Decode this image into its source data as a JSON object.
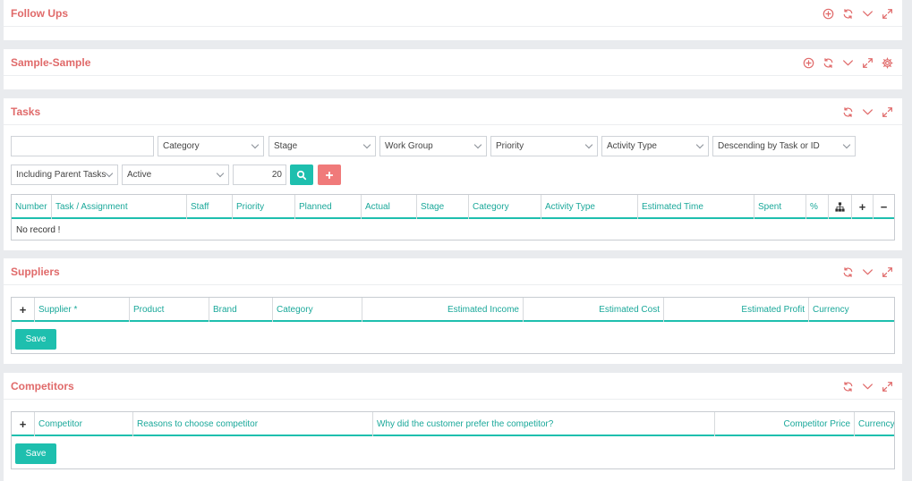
{
  "follow_ups": {
    "title": "Follow Ups"
  },
  "sample": {
    "title": "Sample-Sample"
  },
  "tasks": {
    "title": "Tasks",
    "search": {
      "value": "",
      "placeholder": ""
    },
    "filters": {
      "category": "Category",
      "stage": "Stage",
      "work_group": "Work Group",
      "priority": "Priority",
      "activity_type": "Activity Type",
      "sort": "Descending by Task or ID",
      "parent_tasks": "Including Parent Tasks",
      "status": "Active",
      "page_size": "20"
    },
    "columns": [
      "Number",
      "Task / Assignment",
      "Staff",
      "Priority",
      "Planned",
      "Actual",
      "Stage",
      "Category",
      "Activity Type",
      "Estimated Time",
      "Spent",
      "%"
    ],
    "empty_text": "No record !"
  },
  "suppliers": {
    "title": "Suppliers",
    "columns": [
      "Supplier *",
      "Product",
      "Brand",
      "Category",
      "Estimated Income",
      "Estimated Cost",
      "Estimated Profit",
      "Currency"
    ],
    "save_label": "Save"
  },
  "competitors": {
    "title": "Competitors",
    "columns": [
      "Competitor",
      "Reasons to choose competitor",
      "Why did the customer prefer the competitor?",
      "Competitor Price",
      "Currency"
    ],
    "save_label": "Save"
  },
  "colors": {
    "accent": "#e06a6a",
    "teal": "#1ebfae",
    "danger": "#f07a7a",
    "background": "#e9ebee"
  }
}
